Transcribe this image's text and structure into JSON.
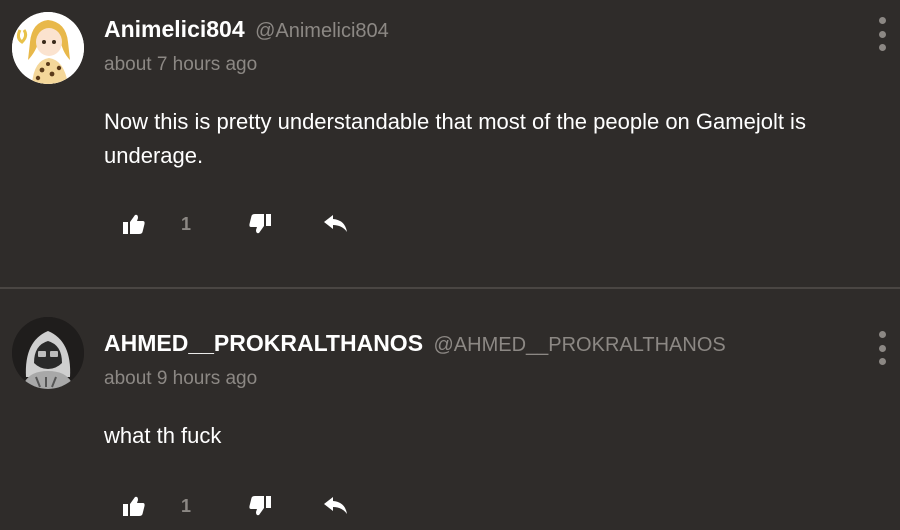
{
  "comments": [
    {
      "display_name": "Animelici804",
      "username": "@Animelici804",
      "time": "about 7 hours ago",
      "body": "Now this is pretty understandable that most of the people on Gamejolt is underage.",
      "like_count": "1",
      "avatar_icon": "anime-girl-avatar",
      "actions": [
        "thumbs-up-icon",
        "thumbs-down-icon",
        "reply-icon"
      ]
    },
    {
      "display_name": "AHMED__PROKRALTHANOS",
      "username": "@AHMED__PROKRALTHANOS",
      "time": "about 9 hours ago",
      "body": "what th fuck",
      "like_count": "1",
      "avatar_icon": "hooded-figure-avatar",
      "actions": [
        "thumbs-up-icon",
        "thumbs-down-icon",
        "reply-icon"
      ]
    }
  ],
  "colors": {
    "background": "#2f2c2a",
    "text": "#ffffff",
    "muted": "#8c8884",
    "divider": "#4a4643"
  }
}
